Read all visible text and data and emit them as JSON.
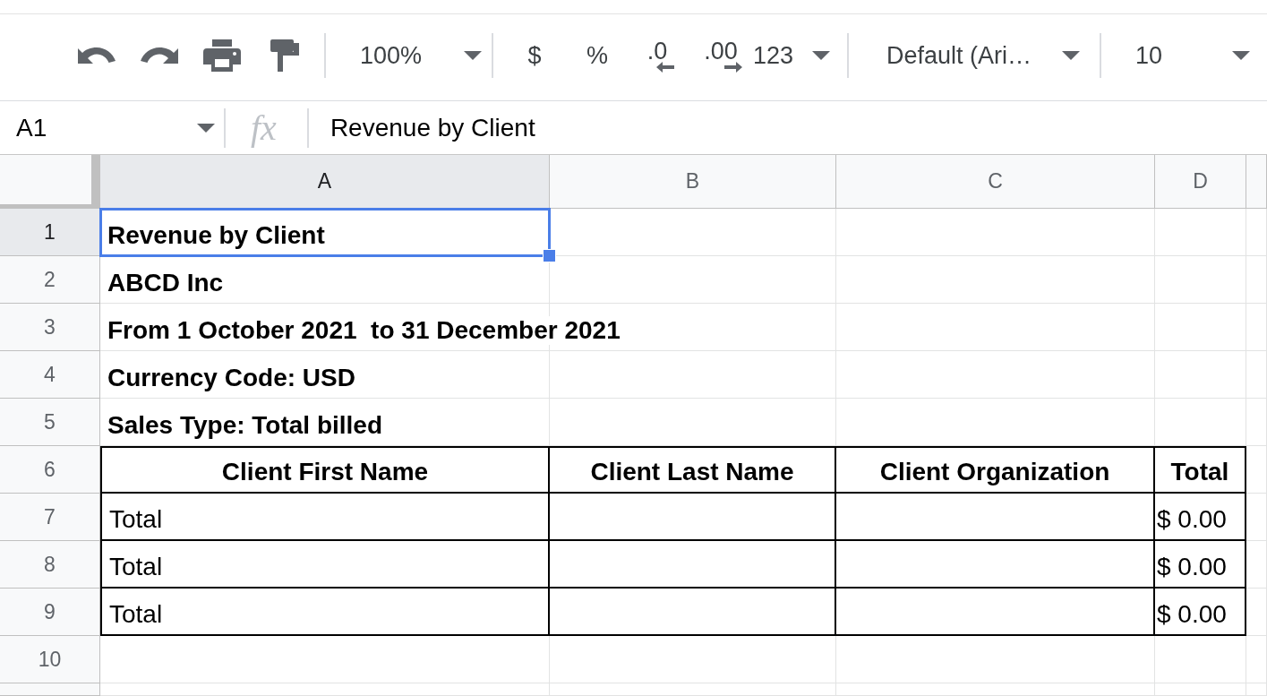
{
  "toolbar": {
    "zoom": "100%",
    "currency": "$",
    "percent": "%",
    "decrease_decimals": ".0",
    "increase_decimals": ".00",
    "number_format": "123",
    "font": "Default (Ari…",
    "font_size": "10"
  },
  "formula_bar": {
    "cell_reference": "A1",
    "function_label": "fx",
    "content": "Revenue by Client"
  },
  "sheet": {
    "columns": [
      {
        "label": "A",
        "selected": true
      },
      {
        "label": "B",
        "selected": false
      },
      {
        "label": "C",
        "selected": false
      },
      {
        "label": "D",
        "selected": false
      }
    ],
    "rows": [
      {
        "number": "1",
        "selected": true,
        "kind": "title",
        "text": "Revenue by Client"
      },
      {
        "number": "2",
        "selected": false,
        "kind": "title",
        "text": "ABCD Inc"
      },
      {
        "number": "3",
        "selected": false,
        "kind": "title",
        "text": "From 1 October 2021  to 31 December 2021"
      },
      {
        "number": "4",
        "selected": false,
        "kind": "title",
        "text": "Currency Code: USD"
      },
      {
        "number": "5",
        "selected": false,
        "kind": "title",
        "text": "Sales Type: Total billed"
      },
      {
        "number": "6",
        "selected": false,
        "kind": "header",
        "headings": [
          "Client First Name",
          "Client Last Name",
          "Client Organization",
          "Total"
        ]
      },
      {
        "number": "7",
        "selected": false,
        "kind": "data",
        "label": "Total",
        "total": "$ 0.00"
      },
      {
        "number": "8",
        "selected": false,
        "kind": "data",
        "label": "Total",
        "total": "$ 0.00"
      },
      {
        "number": "9",
        "selected": false,
        "kind": "data",
        "label": "Total",
        "total": "$ 0.00"
      },
      {
        "number": "10",
        "selected": false,
        "kind": "blank"
      }
    ]
  }
}
